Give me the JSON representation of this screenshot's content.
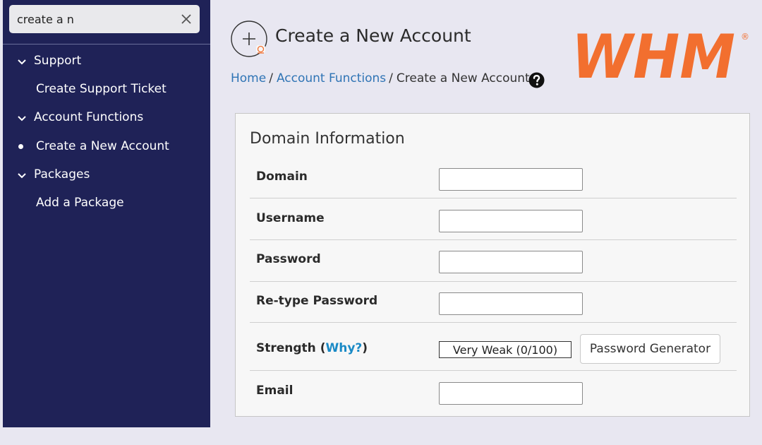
{
  "search": {
    "value": "create a n",
    "placeholder": ""
  },
  "sidebar": {
    "items": [
      {
        "label": "Support",
        "type": "section"
      },
      {
        "label": "Create Support Ticket",
        "type": "link"
      },
      {
        "label": "Account Functions",
        "type": "section"
      },
      {
        "label": "Create a New Account",
        "type": "link",
        "active": true
      },
      {
        "label": "Packages",
        "type": "section"
      },
      {
        "label": "Add a Package",
        "type": "link"
      }
    ]
  },
  "header": {
    "title": "Create a New Account",
    "logo_text": "WHM",
    "logo_mark": "®",
    "breadcrumb": [
      {
        "label": "Home"
      },
      {
        "label": "Account Functions"
      },
      {
        "label": "Create a New Account"
      }
    ],
    "breadcrumb_separator": "/"
  },
  "form": {
    "section_title": "Domain Information",
    "fields": [
      {
        "label": "Domain",
        "value": ""
      },
      {
        "label": "Username",
        "value": ""
      },
      {
        "label": "Password",
        "value": ""
      },
      {
        "label": "Re-type Password",
        "value": ""
      },
      {
        "label": "Email",
        "value": ""
      }
    ],
    "strength": {
      "label_prefix": "Strength (",
      "why_label": "Why?",
      "label_suffix": ")",
      "meter_text": "Very Weak (0/100)",
      "score": 0
    },
    "password_generator_label": "Password Generator"
  },
  "colors": {
    "sidebar_bg": "#1f2257",
    "page_bg": "#e8e7f1",
    "logo_orange": "#f26f2f",
    "link_blue": "#2f74b5",
    "why_blue": "#1a8ac6"
  }
}
